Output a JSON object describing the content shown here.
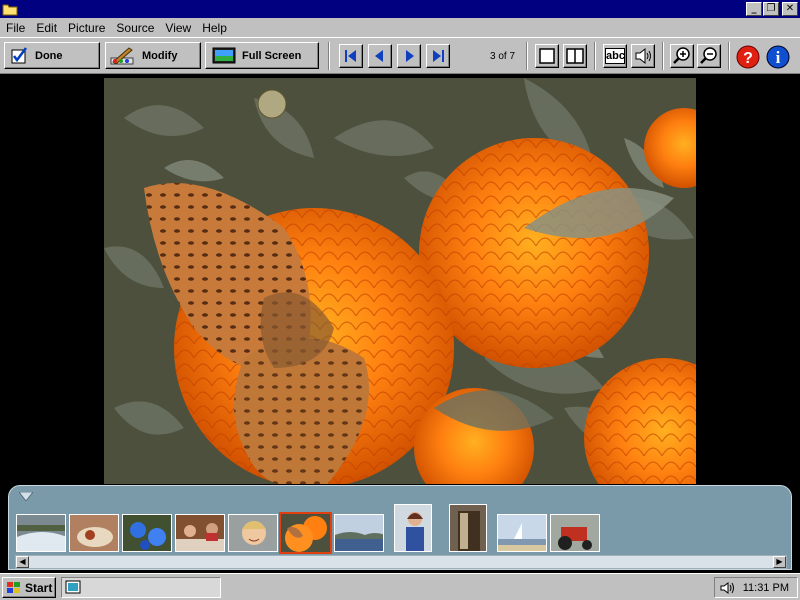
{
  "menu": {
    "items": [
      "File",
      "Edit",
      "Picture",
      "Source",
      "View",
      "Help"
    ]
  },
  "window_controls": {
    "minimize": "_",
    "restore": "❐",
    "close": "✕"
  },
  "toolbar": {
    "done_label": "Done",
    "modify_label": "Modify",
    "fullscreen_label": "Full Screen",
    "counter": "3 of 7",
    "abc_label": "abc"
  },
  "icons": {
    "done": "checkbox-check-icon",
    "modify": "paint-brush-icon",
    "fullscreen": "monitor-icon",
    "first": "first-icon",
    "prev": "previous-icon",
    "next": "next-icon",
    "last": "last-icon",
    "single_view": "single-view-icon",
    "split_view": "split-view-icon",
    "caption": "caption-icon",
    "sound": "speaker-icon",
    "zoom_in": "zoom-in-icon",
    "zoom_out": "zoom-out-icon",
    "help": "help-icon",
    "info": "info-icon"
  },
  "filmstrip": {
    "selected_index": 5,
    "thumbnails": [
      "river-rapids",
      "food-plate",
      "blue-flowers",
      "people-dining",
      "smiling-child",
      "butterfly-marigolds",
      "lake-landscape",
      "person-portrait",
      "doorway",
      "sailboat-shore",
      "red-tractor"
    ]
  },
  "taskbar": {
    "start_label": "Start",
    "clock": "11:31 PM"
  },
  "colors": {
    "titlebar": "#000080",
    "chrome": "#c0c0c0",
    "filmstrip": "#7a9aaa",
    "selected_thumb_border": "#e04010"
  }
}
